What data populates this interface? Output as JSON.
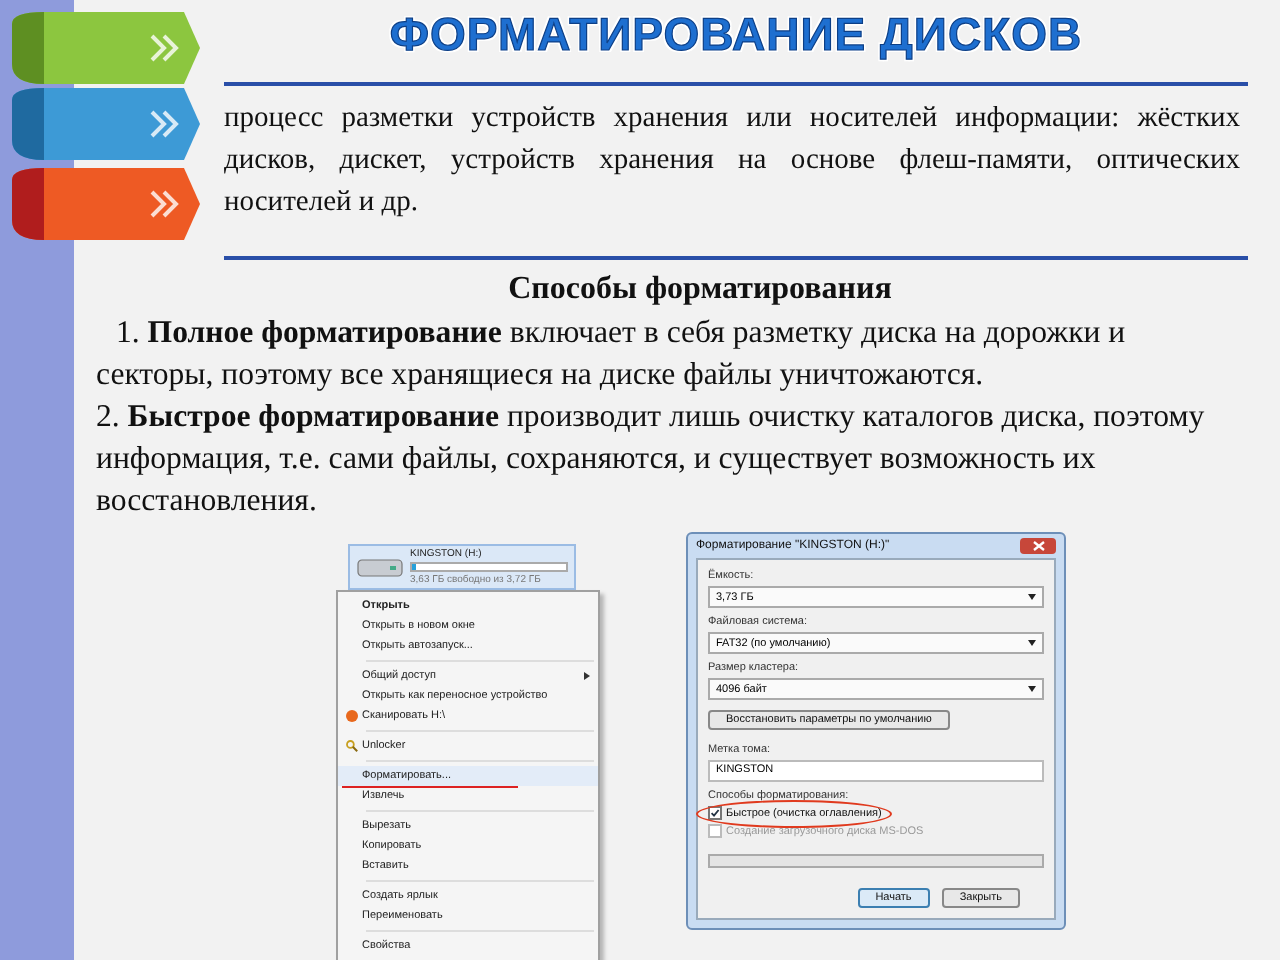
{
  "title": "ФОРМАТИРОВАНИЕ ДИСКОВ",
  "intro": "процесс разметки устройств хранения или носителей информации: жёстких дисков, дискет, устройств хранения на основе флеш-памяти, оптических носителей и др.",
  "section_heading": "Способы форматирования",
  "methods": [
    {
      "number": "1.",
      "text": "**Полное форматирование** включает в себя разметку диска на дорожки и секторы, поэтому все хранящиеся на диске файлы уничтожаются."
    },
    {
      "number": "2.",
      "text": "**Быстрое форматирование** производит лишь очистку каталогов диска, поэтому информация, т.е. сами файлы, сохраняются, и существует возможность их восстановления."
    }
  ],
  "context_menu": {
    "drive": {
      "name": "KINGSTON (H:)",
      "free": "3,63 ГБ свободно из 3,72 ГБ",
      "level": 0.03
    },
    "groups": [
      [
        {
          "label": "Открыть",
          "kind": "default",
          "underlined": false
        },
        {
          "label": "Открыть в новом окне",
          "kind": "plain",
          "underlined": false
        },
        {
          "label": "Открыть автозапуск...",
          "kind": "plain",
          "underlined": false
        }
      ],
      [
        {
          "label": "Общий доступ",
          "kind": "submenu",
          "underlined": false
        },
        {
          "label": "Открыть как переносное устройство",
          "kind": "plain",
          "underlined": false
        },
        {
          "label": "Сканировать H:\\",
          "kind": "scan",
          "underlined": false
        }
      ],
      [
        {
          "label": "Unlocker",
          "kind": "tool",
          "underlined": false
        }
      ],
      [
        {
          "label": "Форматировать...",
          "kind": "plain",
          "underlined": true
        },
        {
          "label": "Извлечь",
          "kind": "plain",
          "underlined": false
        }
      ],
      [
        {
          "label": "Вырезать",
          "kind": "plain",
          "underlined": false
        },
        {
          "label": "Копировать",
          "kind": "plain",
          "underlined": false
        },
        {
          "label": "Вставить",
          "kind": "plain",
          "underlined": false
        }
      ],
      [
        {
          "label": "Создать ярлык",
          "kind": "plain",
          "underlined": false
        },
        {
          "label": "Переименовать",
          "kind": "plain",
          "underlined": false
        }
      ],
      [
        {
          "label": "Свойства",
          "kind": "plain",
          "underlined": false
        }
      ]
    ]
  },
  "format_dialog": {
    "title": "Форматирование \"KINGSTON (H:)\"",
    "fields": [
      {
        "kind": "select",
        "label": "Ёмкость:",
        "value": "3,73 ГБ"
      },
      {
        "kind": "select",
        "label": "Файловая система:",
        "value": "FAT32 (по умолчанию)"
      },
      {
        "kind": "select",
        "label": "Размер кластера:",
        "value": "4096 байт"
      },
      {
        "kind": "button",
        "value": "Восстановить параметры по умолчанию"
      },
      {
        "kind": "text",
        "label": "Метка тома:",
        "value": "KINGSTON"
      }
    ],
    "options_label": "Способы форматирования:",
    "options": [
      {
        "label": "Быстрое (очистка оглавления)",
        "checked": true,
        "disabled": false,
        "circled": true
      },
      {
        "label": "Создание загрузочного диска MS-DOS",
        "checked": false,
        "disabled": true,
        "circled": false
      }
    ],
    "progress": {
      "level": 0
    },
    "buttons": [
      {
        "label": "Начать",
        "default": true
      },
      {
        "label": "Закрыть",
        "default": false
      }
    ]
  }
}
